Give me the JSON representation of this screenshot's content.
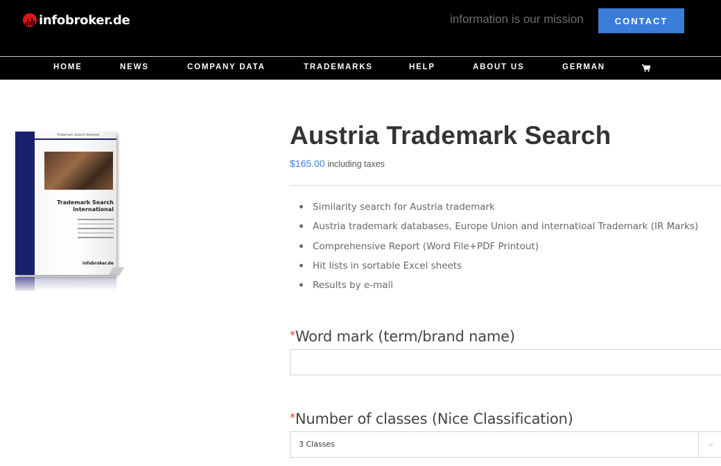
{
  "brand": {
    "name": "infobroker.de",
    "logo_color": "#e0141e"
  },
  "header": {
    "tagline": "information is our mission",
    "contact_label": "CONTACT",
    "accent": "#3b7dd8"
  },
  "nav": {
    "items": [
      {
        "label": "HOME"
      },
      {
        "label": "NEWS"
      },
      {
        "label": "COMPANY DATA"
      },
      {
        "label": "TRADEMARKS"
      },
      {
        "label": "HELP"
      },
      {
        "label": "ABOUT US"
      },
      {
        "label": "GERMAN"
      }
    ],
    "cart_icon": "shopping-cart-icon"
  },
  "product": {
    "image": {
      "header": "Trademark Search Services",
      "title_line1": "Trademark Search",
      "title_line2": "International",
      "brand": "infobroker.de"
    },
    "title": "Austria Trademark Search",
    "price": "$165.00",
    "price_suffix": "including taxes",
    "features": [
      "Similarity search for Austria trademark",
      "Austria  trademark databases, Europe Union and internatioal Trademark (IR Marks)",
      "Comprehensive Report (Word File+PDF Printout)",
      "Hit lists in sortable Excel sheets",
      "Results by e-mail"
    ]
  },
  "form": {
    "required_marker": "*",
    "word_mark": {
      "label": "Word mark (term/brand name)",
      "value": ""
    },
    "classes": {
      "label": "Number of classes (Nice Classification)",
      "selected": "3 Classes",
      "icon": "chevron-down-icon"
    }
  }
}
